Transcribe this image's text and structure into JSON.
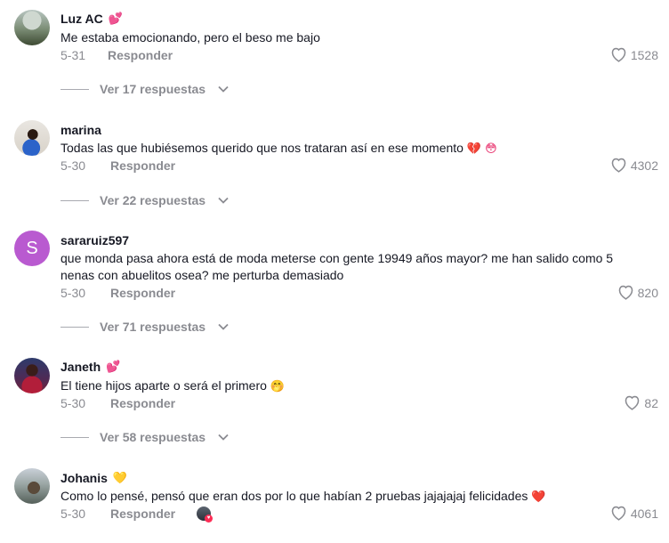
{
  "comments": [
    {
      "username": "Luz AC",
      "badge": "💕",
      "text": "Me estaba emocionando, pero el beso me bajo",
      "date": "5-31",
      "reply_label": "Responder",
      "likes": "1528",
      "replies_label": "Ver 17 respuestas"
    },
    {
      "username": "marina",
      "badge": "",
      "text": "Todas las que hubiésemos querido que nos trataran así en ese momento",
      "text_emoji": "💔 😳",
      "date": "5-30",
      "reply_label": "Responder",
      "likes": "4302",
      "replies_label": "Ver 22 respuestas"
    },
    {
      "username": "sararuiz597",
      "badge": "",
      "avatar_letter": "S",
      "text": "que monda pasa ahora está de moda meterse con gente 19949 años mayor? me han salido como 5 nenas con abuelitos osea? me perturba demasiado",
      "date": "5-30",
      "reply_label": "Responder",
      "likes": "820",
      "replies_label": "Ver 71 respuestas"
    },
    {
      "username": "Janeth",
      "badge": "💕",
      "text": "El tiene hijos aparte o será el primero",
      "text_emoji": "🤭",
      "date": "5-30",
      "reply_label": "Responder",
      "likes": "82",
      "replies_label": "Ver 58 respuestas"
    },
    {
      "username": "Johanis",
      "badge": "💛",
      "text": "Como lo pensé, pensó que eran dos por lo que habían 2 pruebas jajajajaj felicidades",
      "text_emoji": "❤️",
      "date": "5-30",
      "reply_label": "Responder",
      "likes": "4061"
    }
  ],
  "icons": {
    "like": "heart-outline-icon",
    "expand": "chevron-down-icon",
    "creator_liked": "creator-liked-avatar"
  }
}
